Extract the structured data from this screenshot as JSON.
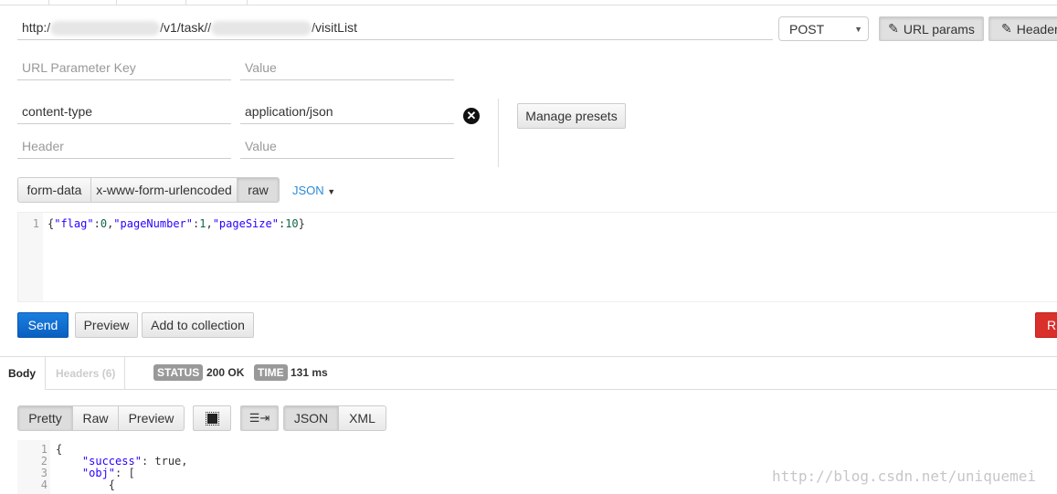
{
  "request": {
    "url_prefix": "http:/",
    "url_mid": "/v1/task//",
    "url_suffix": "/visitList",
    "method": "POST",
    "url_params_label": "URL params",
    "headers_label": "Headers",
    "param_key_placeholder": "URL Parameter Key",
    "param_value_placeholder": "Value",
    "headers": [
      {
        "key": "content-type",
        "value": "application/json"
      }
    ],
    "header_key_placeholder": "Header",
    "header_value_placeholder": "Value",
    "manage_presets": "Manage presets",
    "body_modes": [
      "form-data",
      "x-www-form-urlencoded",
      "raw"
    ],
    "active_mode": "raw",
    "raw_type": "JSON",
    "body_line_no": "1",
    "body_tokens": [
      [
        "p",
        "{"
      ],
      [
        "k",
        "\"flag\""
      ],
      [
        "p",
        ":"
      ],
      [
        "n",
        "0"
      ],
      [
        "p",
        ","
      ],
      [
        "k",
        "\"pageNumber\""
      ],
      [
        "p",
        ":"
      ],
      [
        "n",
        "1"
      ],
      [
        "p",
        ","
      ],
      [
        "k",
        "\"pageSize\""
      ],
      [
        "p",
        ":"
      ],
      [
        "n",
        "10"
      ],
      [
        "p",
        "}"
      ]
    ],
    "send": "Send",
    "preview": "Preview",
    "add_to_collection": "Add to collection",
    "reset_partial": "R"
  },
  "response": {
    "tabs": [
      "Body",
      "Headers (6)"
    ],
    "status_label": "STATUS",
    "status": "200 OK",
    "time_label": "TIME",
    "time": "131 ms",
    "views": [
      "Pretty",
      "Raw",
      "Preview"
    ],
    "formats": [
      "JSON",
      "XML"
    ],
    "line_numbers": [
      "1",
      "2",
      "3",
      "4"
    ],
    "lines": [
      [
        [
          "p",
          "{"
        ]
      ],
      [
        [
          "p",
          "    "
        ],
        [
          "k",
          "\"success\""
        ],
        [
          "p",
          ": true,"
        ]
      ],
      [
        [
          "p",
          "    "
        ],
        [
          "k",
          "\"obj\""
        ],
        [
          "p",
          ": ["
        ]
      ],
      [
        [
          "p",
          "        {"
        ]
      ]
    ]
  },
  "watermark": "http://blog.csdn.net/uniquemei",
  "colors": {
    "send": "#0a68c8",
    "link": "#2a8bd8",
    "danger": "#d9302c"
  }
}
